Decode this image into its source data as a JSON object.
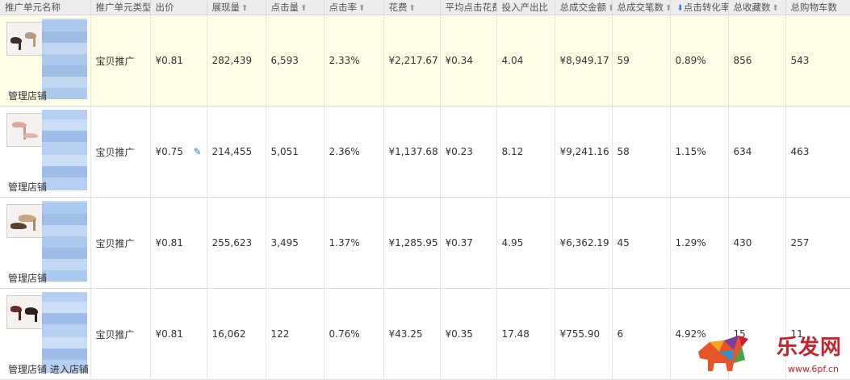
{
  "columns": [
    {
      "label": "推广单元名称",
      "sort": ""
    },
    {
      "label": "推广单元类型",
      "sort": "▼"
    },
    {
      "label": "出价",
      "sort": ""
    },
    {
      "label": "展现量",
      "sort": "⬆"
    },
    {
      "label": "点击量",
      "sort": "⬆"
    },
    {
      "label": "点击率",
      "sort": "⬆"
    },
    {
      "label": "花费",
      "sort": "⬆"
    },
    {
      "label": "平均点击花费",
      "sort": ""
    },
    {
      "label": "投入产出比",
      "sort": ""
    },
    {
      "label": "总成交金额",
      "sort": "⬆"
    },
    {
      "label": "总成交笔数",
      "sort": "⬆"
    },
    {
      "label": "点击转化率",
      "sort": "⬇"
    },
    {
      "label": "总收藏数",
      "sort": "⬆"
    },
    {
      "label": "总购物车数",
      "sort": ""
    }
  ],
  "rows": [
    {
      "shop_label": "管理店铺",
      "type": "宝贝推广",
      "bid": "¥0.81",
      "impressions": "282,439",
      "clicks": "6,593",
      "ctr": "2.33%",
      "cost": "¥2,217.67",
      "cpc": "¥0.34",
      "roi": "4.04",
      "gmv": "¥8,949.17",
      "orders": "59",
      "cvr": "0.89%",
      "favorites": "856",
      "cart": "543"
    },
    {
      "shop_label": "管理店铺",
      "type": "宝贝推广",
      "bid": "¥0.75",
      "impressions": "214,455",
      "clicks": "5,051",
      "ctr": "2.36%",
      "cost": "¥1,137.68",
      "cpc": "¥0.23",
      "roi": "8.12",
      "gmv": "¥9,241.16",
      "orders": "58",
      "cvr": "1.15%",
      "favorites": "634",
      "cart": "463"
    },
    {
      "shop_label": "管理店铺",
      "type": "宝贝推广",
      "bid": "¥0.81",
      "impressions": "255,623",
      "clicks": "3,495",
      "ctr": "1.37%",
      "cost": "¥1,285.95",
      "cpc": "¥0.37",
      "roi": "4.95",
      "gmv": "¥6,362.19",
      "orders": "45",
      "cvr": "1.29%",
      "favorites": "430",
      "cart": "257"
    },
    {
      "shop_label": "管理店铺 进入店铺",
      "type": "宝贝推广",
      "bid": "¥0.81",
      "impressions": "16,062",
      "clicks": "122",
      "ctr": "0.76%",
      "cost": "¥43.25",
      "cpc": "¥0.35",
      "roi": "17.48",
      "gmv": "¥755.90",
      "orders": "6",
      "cvr": "4.92%",
      "favorites": "15",
      "cart": "11"
    }
  ],
  "watermark": {
    "text": "乐发网",
    "url": "www.6pf.cn"
  },
  "colors": {
    "header_bg": "#ededed",
    "highlight_row": "#fefee6",
    "accent": "#2a7bd8",
    "watermark": "#c0262c"
  }
}
